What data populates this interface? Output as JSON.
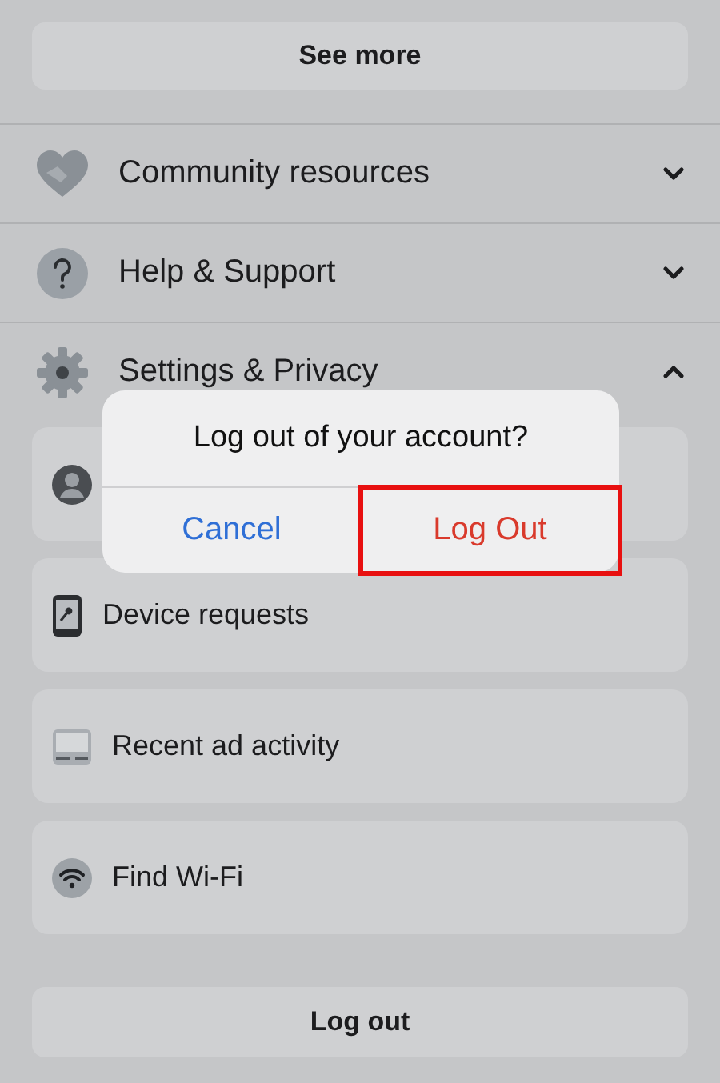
{
  "see_more": {
    "label": "See more"
  },
  "sections": [
    {
      "kind": "community",
      "label": "Community resources",
      "expanded": false
    },
    {
      "kind": "help",
      "label": "Help & Support",
      "expanded": false
    },
    {
      "kind": "settings",
      "label": "Settings & Privacy",
      "expanded": true
    }
  ],
  "settings_items": [
    {
      "kind": "account"
    },
    {
      "kind": "device",
      "label": "Device requests"
    },
    {
      "kind": "ads",
      "label": "Recent ad activity"
    },
    {
      "kind": "wifi",
      "label": "Find Wi-Fi"
    }
  ],
  "logout_button": {
    "label": "Log out"
  },
  "dialog": {
    "title": "Log out of your account?",
    "buttons": [
      {
        "kind": "cancel",
        "label": "Cancel",
        "highlighted": false
      },
      {
        "kind": "destructive",
        "label": "Log Out",
        "highlighted": true
      }
    ]
  }
}
